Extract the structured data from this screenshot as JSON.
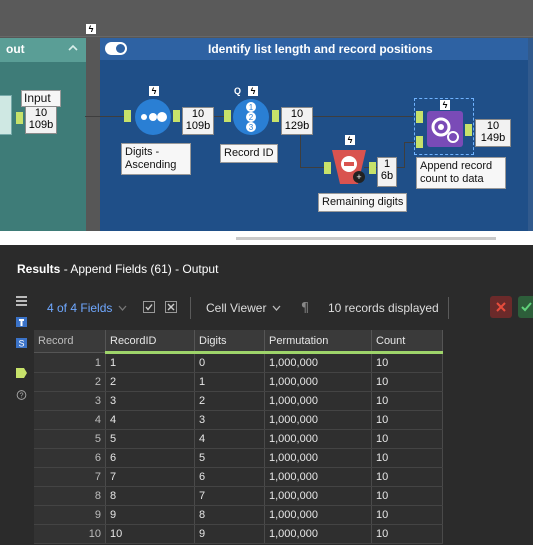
{
  "canvas": {
    "left_container": {
      "title": "out"
    },
    "main_container": {
      "title": "Identify list length and record positions"
    },
    "tools": {
      "input": {
        "label": "Input",
        "count": "10",
        "size": "109b"
      },
      "digits_ascending": {
        "label_line1": "Digits -",
        "label_line2": "Ascending",
        "count": "10",
        "size": "109b"
      },
      "record_id": {
        "label": "Record ID",
        "count": "10",
        "size": "129b",
        "tag": "Q"
      },
      "remaining_digits": {
        "label": "Remaining digits",
        "count": "1",
        "size": "6b"
      },
      "append": {
        "label_line1": "Append record",
        "label_line2": "count to data",
        "count": "10",
        "size": "149b"
      }
    }
  },
  "results": {
    "title_bold": "Results",
    "title_rest": " - Append Fields (61) - Output",
    "toolbar": {
      "fields": "4 of 4 Fields",
      "viewer": "Cell Viewer",
      "records_displayed": "10 records displayed"
    },
    "table": {
      "columns": [
        "Record",
        "RecordID",
        "Digits",
        "Permutation",
        "Count"
      ],
      "rows": [
        [
          "1",
          "1",
          "0",
          "1,000,000",
          "10"
        ],
        [
          "2",
          "2",
          "1",
          "1,000,000",
          "10"
        ],
        [
          "3",
          "3",
          "2",
          "1,000,000",
          "10"
        ],
        [
          "4",
          "4",
          "3",
          "1,000,000",
          "10"
        ],
        [
          "5",
          "5",
          "4",
          "1,000,000",
          "10"
        ],
        [
          "6",
          "6",
          "5",
          "1,000,000",
          "10"
        ],
        [
          "7",
          "7",
          "6",
          "1,000,000",
          "10"
        ],
        [
          "8",
          "8",
          "7",
          "1,000,000",
          "10"
        ],
        [
          "9",
          "9",
          "8",
          "1,000,000",
          "10"
        ],
        [
          "10",
          "10",
          "9",
          "1,000,000",
          "10"
        ]
      ]
    }
  },
  "colors": {
    "accent_green": "#9ed46a",
    "container_blue": "#1f4f88",
    "close_red": "#c0392b"
  }
}
